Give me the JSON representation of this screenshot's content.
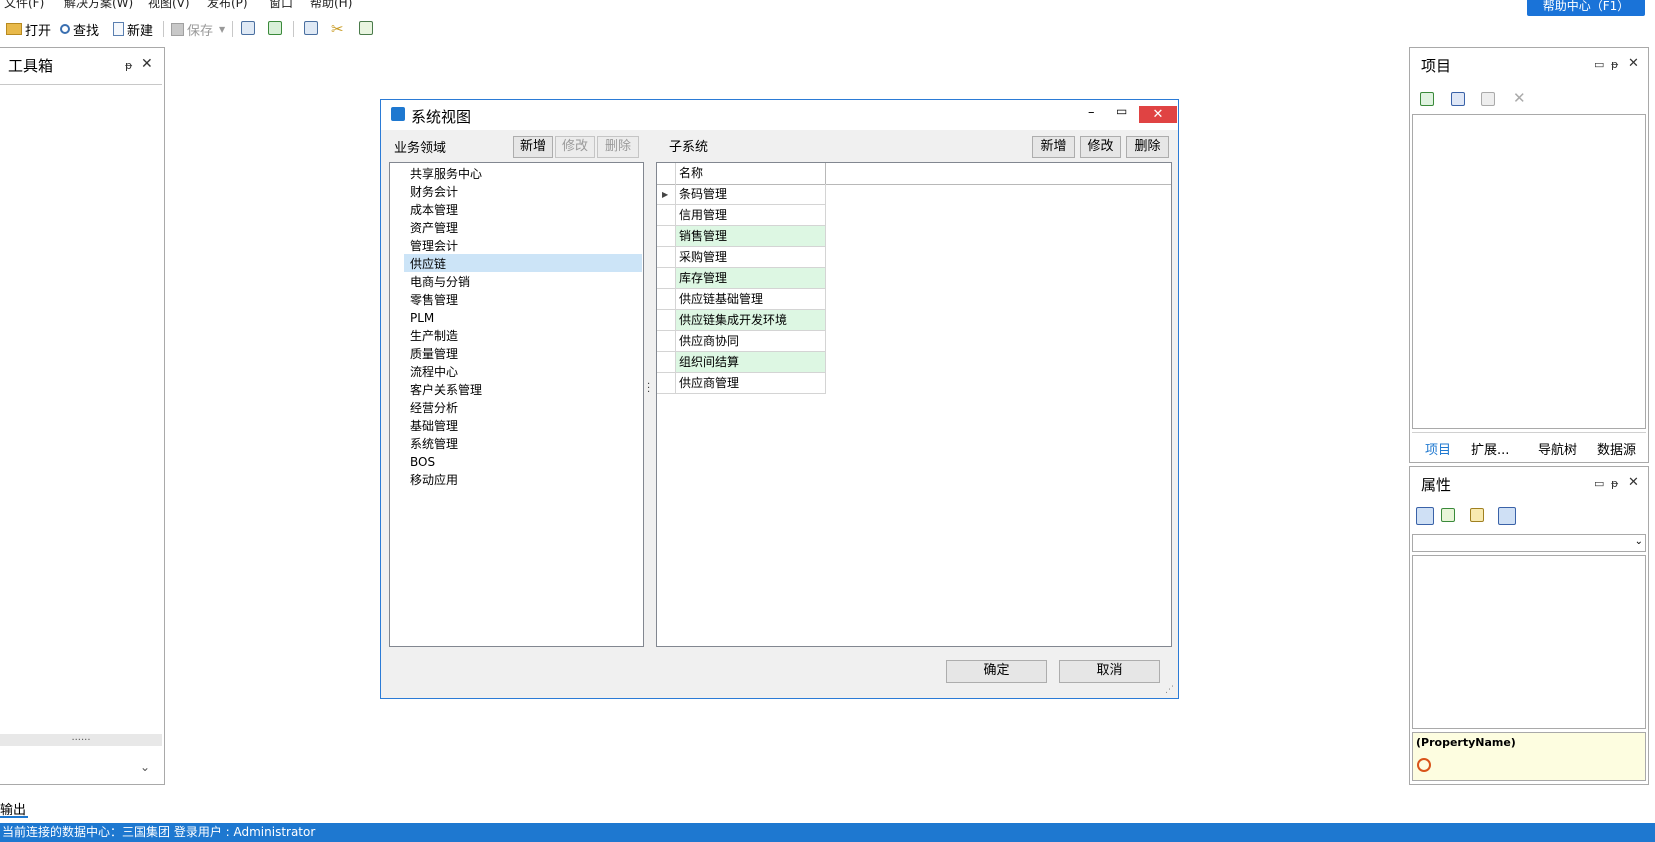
{
  "menubar": {
    "items": [
      "文件(F)",
      "解决方案(W)",
      "视图(V)",
      "发布(P)",
      "窗口",
      "帮助(H)"
    ],
    "help_center": "帮助中心（F1）"
  },
  "toolbar": {
    "open": "打开",
    "find": "查找",
    "new": "新建",
    "save": "保存"
  },
  "toolbox": {
    "title": "工具箱",
    "grip": "......"
  },
  "output": {
    "label": "输出"
  },
  "project_panel": {
    "title": "项目",
    "tabs": [
      "项目",
      "扩展...",
      "导航树",
      "数据源"
    ]
  },
  "properties_panel": {
    "title": "属性",
    "property_name": "(PropertyName)"
  },
  "dialog": {
    "title": "系统视图",
    "domain_label": "业务领域",
    "subsystem_label": "子系统",
    "add": "新增",
    "edit": "修改",
    "delete": "删除",
    "domains": [
      "共享服务中心",
      "财务会计",
      "成本管理",
      "资产管理",
      "管理会计",
      "供应链",
      "电商与分销",
      "零售管理",
      "PLM",
      "生产制造",
      "质量管理",
      "流程中心",
      "客户关系管理",
      "经营分析",
      "基础管理",
      "系统管理",
      "BOS",
      "移动应用"
    ],
    "selected_domain": "供应链",
    "grid_header": "名称",
    "subsystems": [
      "条码管理",
      "信用管理",
      "销售管理",
      "采购管理",
      "库存管理",
      "供应链基础管理",
      "供应链集成开发环境",
      "供应商协同",
      "组织间结算",
      "供应商管理"
    ],
    "ok": "确定",
    "cancel": "取消"
  },
  "statusbar": {
    "text": "当前连接的数据中心：三国集团  登录用户 : Administrator"
  },
  "colors": {
    "accent": "#1e78d0",
    "selection": "#cce4f7",
    "alt_row": "#ddf7e3",
    "close_red": "#e04343"
  }
}
